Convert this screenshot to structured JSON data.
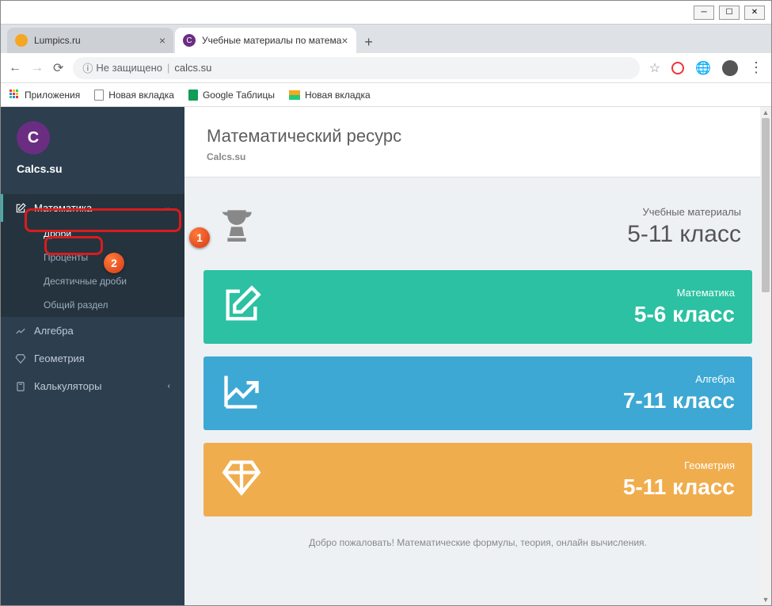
{
  "window": {
    "tabs": [
      {
        "title": "Lumpics.ru",
        "favicon_color": "#f5a623"
      },
      {
        "title": "Учебные материалы по матема",
        "favicon_color": "#6b2d82",
        "favicon_letter": "С"
      }
    ],
    "address": {
      "insecure_label": "Не защищено",
      "domain": "calcs.su"
    },
    "bookmarks": [
      {
        "label": "Приложения",
        "type": "apps"
      },
      {
        "label": "Новая вкладка",
        "type": "doc"
      },
      {
        "label": "Google Таблицы",
        "type": "sheets"
      },
      {
        "label": "Новая вкладка",
        "type": "img"
      }
    ]
  },
  "sidebar": {
    "brand_letter": "С",
    "brand_name": "Calcs.su",
    "items": [
      {
        "label": "Математика",
        "icon": "edit",
        "expanded": true,
        "subs": [
          "Дроби",
          "Проценты",
          "Десятичные дроби",
          "Общий раздел"
        ]
      },
      {
        "label": "Алгебра",
        "icon": "chart"
      },
      {
        "label": "Геометрия",
        "icon": "diamond"
      },
      {
        "label": "Калькуляторы",
        "icon": "calc"
      }
    ]
  },
  "page": {
    "title": "Математический ресурс",
    "subtitle": "Calcs.su",
    "hero": {
      "small": "Учебные материалы",
      "big": "5-11 класс"
    },
    "cards": [
      {
        "color": "green",
        "small": "Математика",
        "big": "5-6 класс",
        "icon": "edit"
      },
      {
        "color": "blue",
        "small": "Алгебра",
        "big": "7-11 класс",
        "icon": "chart"
      },
      {
        "color": "orange",
        "small": "Геометрия",
        "big": "5-11 класс",
        "icon": "diamond"
      }
    ],
    "footer": "Добро пожаловать! Математические формулы, теория, онлайн вычисления."
  },
  "annotations": {
    "one": "1",
    "two": "2"
  }
}
